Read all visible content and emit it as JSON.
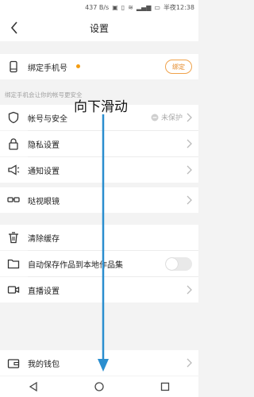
{
  "status_bar": {
    "speed": "437 B/s",
    "battery_text": "半夜12:38"
  },
  "header": {
    "title": "设置"
  },
  "bind_phone": {
    "label": "绑定手机号",
    "button": "绑定",
    "hint": "绑定手机会让你的帐号更安全"
  },
  "account_security": {
    "label": "帐号与安全",
    "status": "未保护"
  },
  "privacy": {
    "label": "隐私设置"
  },
  "notifications": {
    "label": "通知设置"
  },
  "glasses": {
    "label": "哒视眼镜"
  },
  "clear_cache": {
    "label": "清除缓存"
  },
  "auto_save": {
    "label": "自动保存作品到本地作品集",
    "enabled": false
  },
  "live": {
    "label": "直播设置"
  },
  "wallet": {
    "label": "我的钱包"
  },
  "overlay": {
    "text": "向下滑动"
  },
  "colors": {
    "accent": "#f39c12",
    "arrow": "#2a8ecf"
  }
}
